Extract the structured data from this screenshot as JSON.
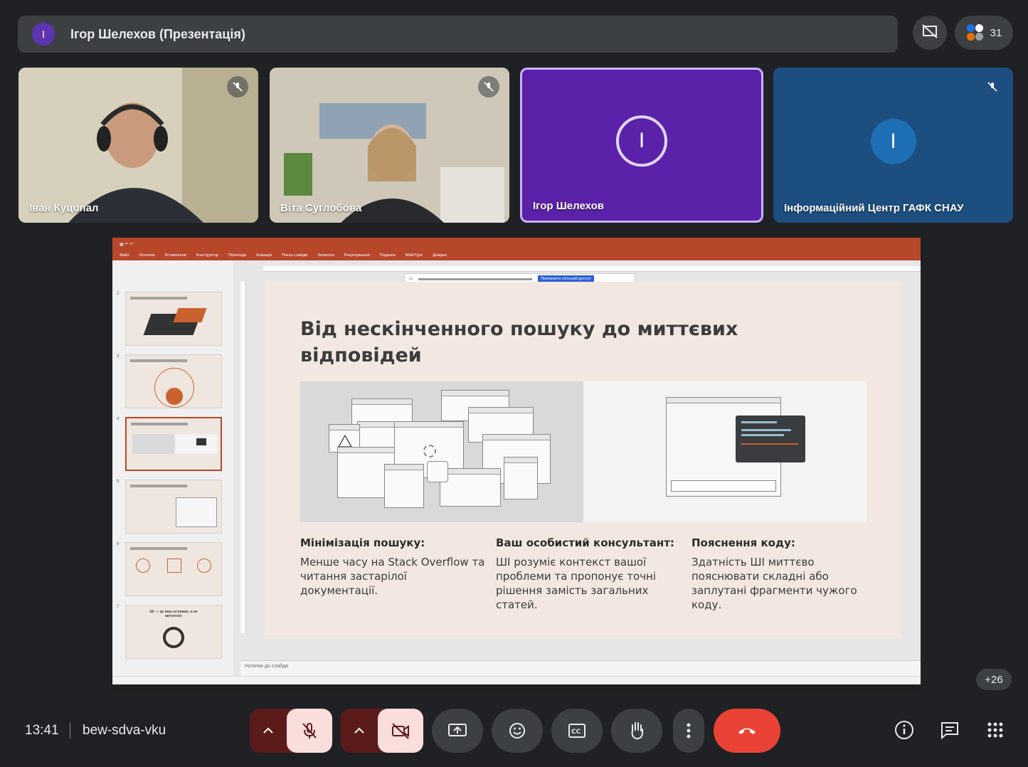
{
  "top_bar": {
    "avatar_letter": "І",
    "title": "Ігор Шелехов (Презентація)",
    "participants_count": "31"
  },
  "tiles": [
    {
      "name": "Іван Куцопал"
    },
    {
      "name": "Віта Суглобова"
    },
    {
      "name": "Ігор Шелехов",
      "avatar_letter": "І"
    },
    {
      "name": "Інформаційний Центр ГАФК СНАУ",
      "avatar_letter": "І"
    }
  ],
  "presentation": {
    "ribbon_tabs": [
      "Файл",
      "Основне",
      "Вставлення",
      "Конструктор",
      "Переходи",
      "Анімація",
      "Показ слайдів",
      "Записати",
      "Рецензування",
      "Подання",
      "MathType",
      "Довідка"
    ],
    "notice_button": "Припинити спільний доступ",
    "notes_placeholder": "Нотатки до слайда",
    "slide": {
      "title": "Від нескінченного пошуку до миттєвих відповідей",
      "columns": [
        {
          "heading": "Мінімізація пошуку:",
          "text": "Менше часу на Stack Overflow та читання застарілої документації."
        },
        {
          "heading": "Ваш особистий консультант:",
          "text": "ШІ розуміє контекст вашої проблеми та пропонує точні рішення замість загальних статей."
        },
        {
          "heading": "Пояснення коду:",
          "text": "Здатність ШІ миттєво пояснювати складні або заплутані фрагменти чужого коду."
        }
      ]
    },
    "thumb_numbers": [
      "2",
      "3",
      "4",
      "5",
      "6",
      "7"
    ],
    "thumb_7_title": "ШІ — це ваш штурман, а не автопілот"
  },
  "more_participants": "+26",
  "bottom": {
    "time": "13:41",
    "meeting_code": "bew-sdva-vku"
  },
  "colors": {
    "background": "#202124",
    "end_call": "#ea4335",
    "active_tile_border": "#c9b3ff"
  }
}
